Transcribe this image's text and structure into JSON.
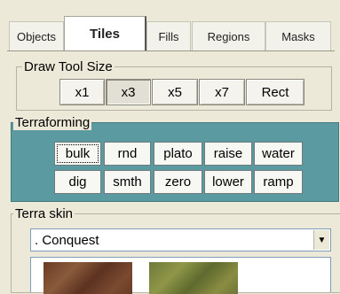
{
  "tabs": [
    {
      "label": "Objects",
      "active": false
    },
    {
      "label": "Tiles",
      "active": true
    },
    {
      "label": "Fills",
      "active": false
    },
    {
      "label": "Regions",
      "active": false
    },
    {
      "label": "Masks",
      "active": false
    }
  ],
  "draw_tool_size": {
    "legend": "Draw Tool Size",
    "buttons": [
      "x1",
      "x3",
      "x5",
      "x7",
      "Rect"
    ],
    "selected": "x3"
  },
  "terraforming": {
    "legend": "Terraforming",
    "row1": [
      "bulk",
      "rnd",
      "plato",
      "raise",
      "water"
    ],
    "row2": [
      "dig",
      "smth",
      "zero",
      "lower",
      "ramp"
    ],
    "selected": "bulk",
    "panel_color": "#5a9aa0"
  },
  "terra_skin": {
    "legend": "Terra skin",
    "selected_value": ". Conquest",
    "dropdown_icon": "triangle-down-icon"
  }
}
